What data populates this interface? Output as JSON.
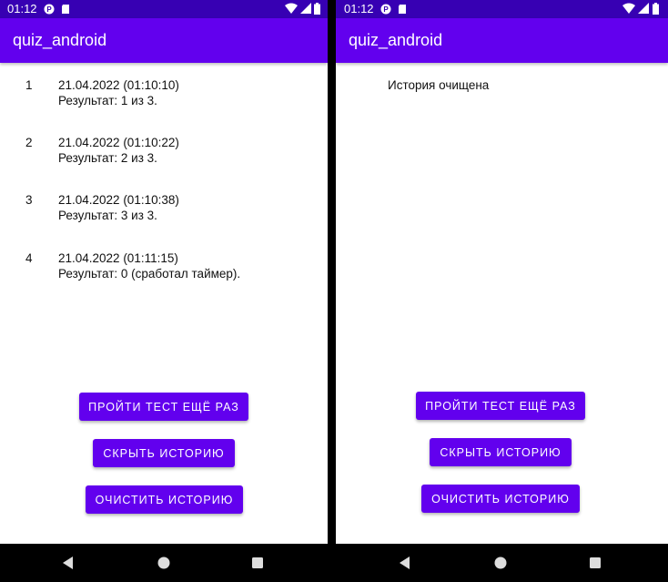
{
  "status_bar": {
    "time": "01:12"
  },
  "app_title": "quiz_android",
  "left_screen": {
    "history": [
      {
        "index": "1",
        "date": "21.04.2022 (01:10:10)",
        "result": "Результат: 1 из 3."
      },
      {
        "index": "2",
        "date": "21.04.2022 (01:10:22)",
        "result": "Результат: 2 из 3."
      },
      {
        "index": "3",
        "date": "21.04.2022 (01:10:38)",
        "result": "Результат: 3 из 3."
      },
      {
        "index": "4",
        "date": "21.04.2022 (01:11:15)",
        "result": "Результат: 0 (сработал таймер)."
      }
    ],
    "buttons": {
      "retry": "ПРОЙТИ ТЕСТ ЕЩЁ РАЗ",
      "hide_history": "СКРЫТЬ ИСТОРИЮ",
      "clear_history": "ОЧИСТИТЬ ИСТОРИЮ"
    }
  },
  "right_screen": {
    "message": "История очищена",
    "buttons": {
      "retry": "ПРОЙТИ ТЕСТ ЕЩЁ РАЗ",
      "hide_history": "СКРЫТЬ ИСТОРИЮ",
      "clear_history": "ОЧИСТИТЬ ИСТОРИЮ"
    }
  },
  "colors": {
    "status_bar": "#3700b3",
    "app_bar": "#6200ee",
    "button": "#6200ee",
    "nav_bar": "#000000"
  },
  "icons": [
    "notification-p-icon",
    "sd-card-icon",
    "wifi-icon",
    "signal-icon",
    "battery-icon",
    "back-icon",
    "home-icon",
    "recents-icon"
  ]
}
